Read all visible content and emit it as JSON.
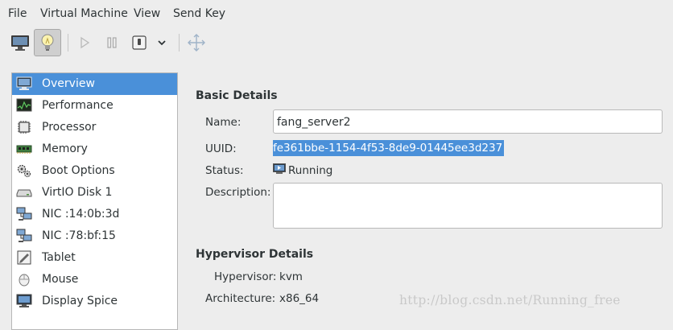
{
  "menu": {
    "file": "File",
    "virtual_machine": "Virtual Machine",
    "view": "View",
    "send_key": "Send Key"
  },
  "toolbar": {
    "icons": [
      "console-icon",
      "details-lightbulb-icon",
      "run-icon",
      "pause-icon",
      "shutdown-icon",
      "chevron-down-icon",
      "fullscreen-icon"
    ]
  },
  "sidebar": {
    "items": [
      {
        "label": "Overview",
        "icon": "overview-monitor-icon",
        "selected": true
      },
      {
        "label": "Performance",
        "icon": "performance-graph-icon"
      },
      {
        "label": "Processor",
        "icon": "processor-chip-icon"
      },
      {
        "label": "Memory",
        "icon": "memory-module-icon"
      },
      {
        "label": "Boot Options",
        "icon": "boot-gears-icon"
      },
      {
        "label": "VirtIO Disk 1",
        "icon": "disk-icon"
      },
      {
        "label": "NIC :14:0b:3d",
        "icon": "network-icon"
      },
      {
        "label": "NIC :78:bf:15",
        "icon": "network-icon"
      },
      {
        "label": "Tablet",
        "icon": "tablet-icon"
      },
      {
        "label": "Mouse",
        "icon": "mouse-icon"
      },
      {
        "label": "Display Spice",
        "icon": "display-icon"
      }
    ]
  },
  "basic": {
    "title": "Basic Details",
    "name_label": "Name:",
    "name_value": "fang_server2",
    "uuid_label": "UUID:",
    "uuid_value": "fe361bbe-1154-4f53-8de9-01445ee3d237",
    "status_label": "Status:",
    "status_value": "Running",
    "description_label": "Description:",
    "description_value": ""
  },
  "hypervisor": {
    "title": "Hypervisor Details",
    "hypervisor_label": "Hypervisor:",
    "hypervisor_value": "kvm",
    "architecture_label": "Architecture:",
    "architecture_value": "x86_64"
  },
  "watermark": "http://blog.csdn.net/Running_free",
  "colors": {
    "selection": "#4a90d9",
    "window_bg": "#ededed"
  }
}
